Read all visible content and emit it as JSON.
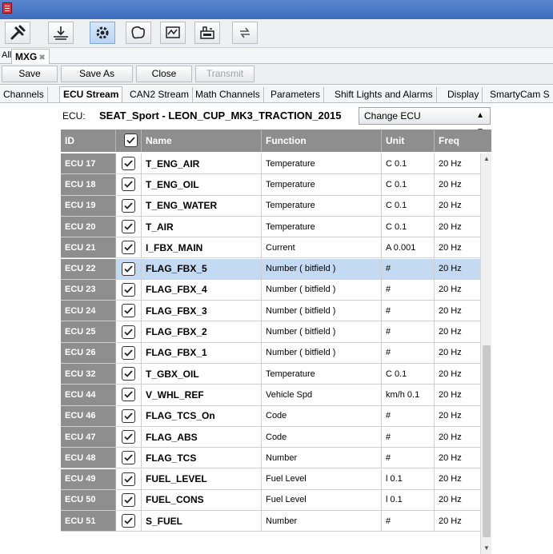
{
  "toolbar": {
    "icons": [
      "wrench-icon",
      "ground-level-icon",
      "gear-engine-icon",
      "track-map-icon",
      "dashboard-graph-icon",
      "ecu-box-icon",
      "transfer-icon"
    ]
  },
  "doc_tabs": {
    "all_label": "All",
    "active_label": "MXG",
    "close_glyph": "✖"
  },
  "actions": {
    "save": "Save",
    "save_as": "Save As",
    "close": "Close",
    "transmit": "Transmit"
  },
  "page_tabs": [
    "Channels",
    "ECU Stream",
    "CAN2 Stream",
    "Math Channels",
    "Parameters",
    "Shift Lights and Alarms",
    "Display",
    "SmartyCam S"
  ],
  "ecu": {
    "label": "ECU:",
    "name": "SEAT_Sport - LEON_CUP_MK3_TRACTION_2015",
    "change_label": "Change ECU"
  },
  "grid": {
    "headers": {
      "id": "ID",
      "name": "Name",
      "function": "Function",
      "unit": "Unit",
      "freq": "Freq"
    },
    "rows": [
      {
        "id": "ECU 17",
        "name": "T_ENG_AIR",
        "function": "Temperature",
        "unit": "C 0.1",
        "freq": "20 Hz",
        "checked": true,
        "selected": false
      },
      {
        "id": "ECU 18",
        "name": "T_ENG_OIL",
        "function": "Temperature",
        "unit": "C 0.1",
        "freq": "20 Hz",
        "checked": true,
        "selected": false
      },
      {
        "id": "ECU 19",
        "name": "T_ENG_WATER",
        "function": "Temperature",
        "unit": "C 0.1",
        "freq": "20 Hz",
        "checked": true,
        "selected": false
      },
      {
        "id": "ECU 20",
        "name": "T_AIR",
        "function": "Temperature",
        "unit": "C 0.1",
        "freq": "20 Hz",
        "checked": true,
        "selected": false
      },
      {
        "id": "ECU 21",
        "name": "I_FBX_MAIN",
        "function": "Current",
        "unit": "A 0.001",
        "freq": "20 Hz",
        "checked": true,
        "selected": false
      },
      {
        "id": "ECU 22",
        "name": "FLAG_FBX_5",
        "function": "Number  ( bitfield )",
        "unit": "#",
        "freq": "20 Hz",
        "checked": true,
        "selected": true
      },
      {
        "id": "ECU 23",
        "name": "FLAG_FBX_4",
        "function": "Number  ( bitfield )",
        "unit": "#",
        "freq": "20 Hz",
        "checked": true,
        "selected": false
      },
      {
        "id": "ECU 24",
        "name": "FLAG_FBX_3",
        "function": "Number  ( bitfield )",
        "unit": "#",
        "freq": "20 Hz",
        "checked": true,
        "selected": false
      },
      {
        "id": "ECU 25",
        "name": "FLAG_FBX_2",
        "function": "Number  ( bitfield )",
        "unit": "#",
        "freq": "20 Hz",
        "checked": true,
        "selected": false
      },
      {
        "id": "ECU 26",
        "name": "FLAG_FBX_1",
        "function": "Number  ( bitfield )",
        "unit": "#",
        "freq": "20 Hz",
        "checked": true,
        "selected": false
      },
      {
        "id": "ECU 32",
        "name": "T_GBX_OIL",
        "function": "Temperature",
        "unit": "C 0.1",
        "freq": "20 Hz",
        "checked": true,
        "selected": false
      },
      {
        "id": "ECU 44",
        "name": "V_WHL_REF",
        "function": "Vehicle Spd",
        "unit": "km/h 0.1",
        "freq": "20 Hz",
        "checked": true,
        "selected": false
      },
      {
        "id": "ECU 46",
        "name": "FLAG_TCS_On",
        "function": "Code",
        "unit": "#",
        "freq": "20 Hz",
        "checked": true,
        "selected": false
      },
      {
        "id": "ECU 47",
        "name": "FLAG_ABS",
        "function": "Code",
        "unit": "#",
        "freq": "20 Hz",
        "checked": true,
        "selected": false
      },
      {
        "id": "ECU 48",
        "name": "FLAG_TCS",
        "function": "Number",
        "unit": "#",
        "freq": "20 Hz",
        "checked": true,
        "selected": false
      },
      {
        "id": "ECU 49",
        "name": "FUEL_LEVEL",
        "function": "Fuel Level",
        "unit": "l 0.1",
        "freq": "20 Hz",
        "checked": true,
        "selected": false
      },
      {
        "id": "ECU 50",
        "name": "FUEL_CONS",
        "function": "Fuel Level",
        "unit": "l 0.1",
        "freq": "20 Hz",
        "checked": true,
        "selected": false
      },
      {
        "id": "ECU 51",
        "name": "S_FUEL",
        "function": "Number",
        "unit": "#",
        "freq": "20 Hz",
        "checked": true,
        "selected": false
      }
    ]
  },
  "colors": {
    "title_bar": "#3c6bbd",
    "grid_header": "#8e8e8e",
    "selected_row": "#c4d9f2"
  }
}
